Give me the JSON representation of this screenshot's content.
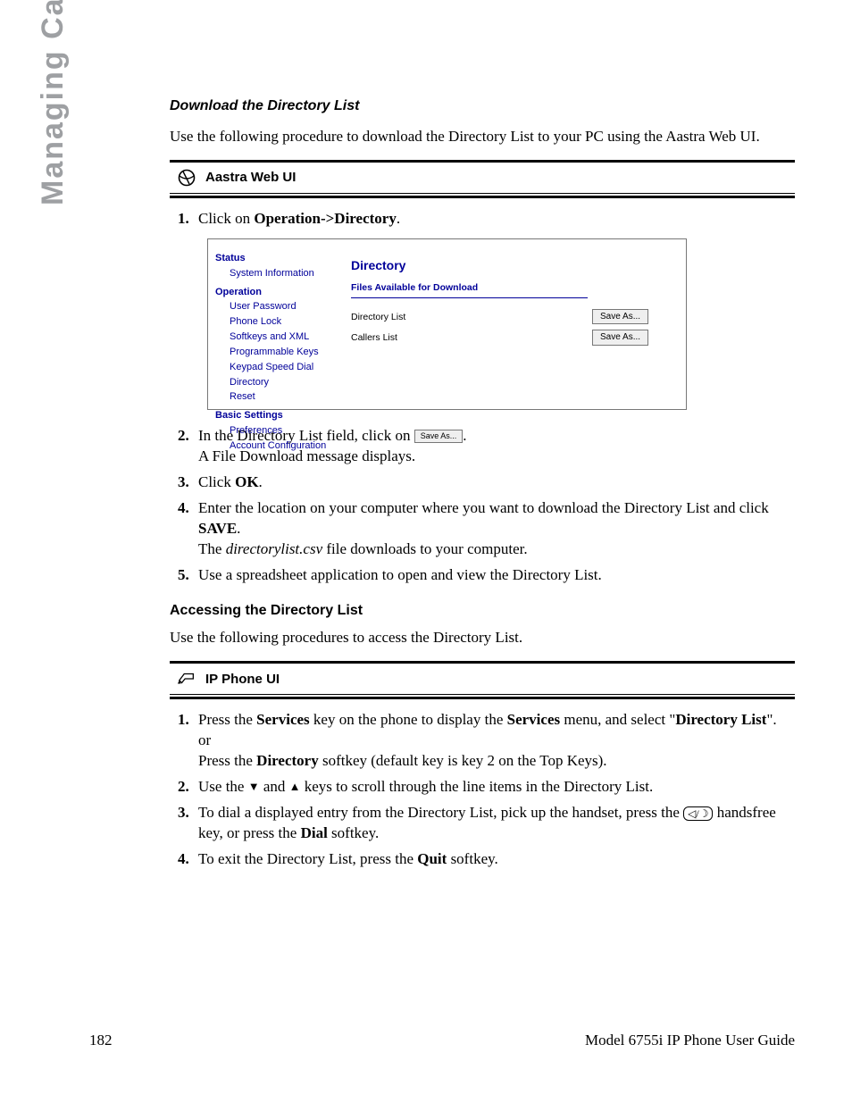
{
  "side_title": "Managing Calls",
  "section1": {
    "title": "Download the Directory List",
    "intro": "Use the following procedure to download the Directory List to your PC using the Aastra Web UI.",
    "panel_label": "Aastra Web UI",
    "step1_a": "Click on ",
    "step1_b": "Operation->Directory",
    "step1_c": "."
  },
  "screenshot": {
    "nav": {
      "status": "Status",
      "sysinfo": "System Information",
      "operation": "Operation",
      "userpw": "User Password",
      "phonelock": "Phone Lock",
      "softxml": "Softkeys and XML",
      "progkeys": "Programmable Keys",
      "speeddial": "Keypad Speed Dial",
      "directory": "Directory",
      "reset": "Reset",
      "basic": "Basic Settings",
      "prefs": "Preferences",
      "acct": "Account Configuration"
    },
    "main": {
      "title": "Directory",
      "subtitle": "Files Available for Download",
      "row1_label": "Directory List",
      "row2_label": "Callers List",
      "btn": "Save As..."
    }
  },
  "steps_after": {
    "s2a": "In the Directory List field, click on ",
    "s2btn": "Save As...",
    "s2b": ".",
    "s2c": "A File Download message displays.",
    "s3a": "Click ",
    "s3b": "OK",
    "s3c": ".",
    "s4a": "Enter the location on your computer where you want to download the Directory List and click ",
    "s4b": "SAVE",
    "s4c": ".",
    "s4d1": "The ",
    "s4d2": "directorylist.csv",
    "s4d3": " file downloads to your computer.",
    "s5": "Use a spreadsheet application to open and view the Directory List."
  },
  "section2": {
    "title": "Accessing the Directory List",
    "intro": "Use the following procedures to access the Directory List.",
    "panel_label": "IP Phone UI",
    "s1a": "Press the ",
    "s1b": "Services",
    "s1c": " key on the phone to display the ",
    "s1d": "Services",
    "s1e": " menu, and select \"",
    "s1f": "Directory List",
    "s1g": "\".",
    "s1or": "or",
    "s1h": "Press the ",
    "s1i": "Directory",
    "s1j": " softkey (default key is key 2 on the Top Keys).",
    "s2a": "Use the ",
    "s2b": " and ",
    "s2c": " keys to scroll through the line items in the Directory List.",
    "s3a": "To dial a displayed entry from the Directory List, pick up the handset, press the ",
    "s3b": " handsfree key, or press the ",
    "s3c": "Dial",
    "s3d": " softkey.",
    "s4a": "To exit the Directory List, press the ",
    "s4b": "Quit",
    "s4c": " softkey."
  },
  "footer": {
    "page": "182",
    "title": "Model 6755i IP Phone User Guide"
  }
}
